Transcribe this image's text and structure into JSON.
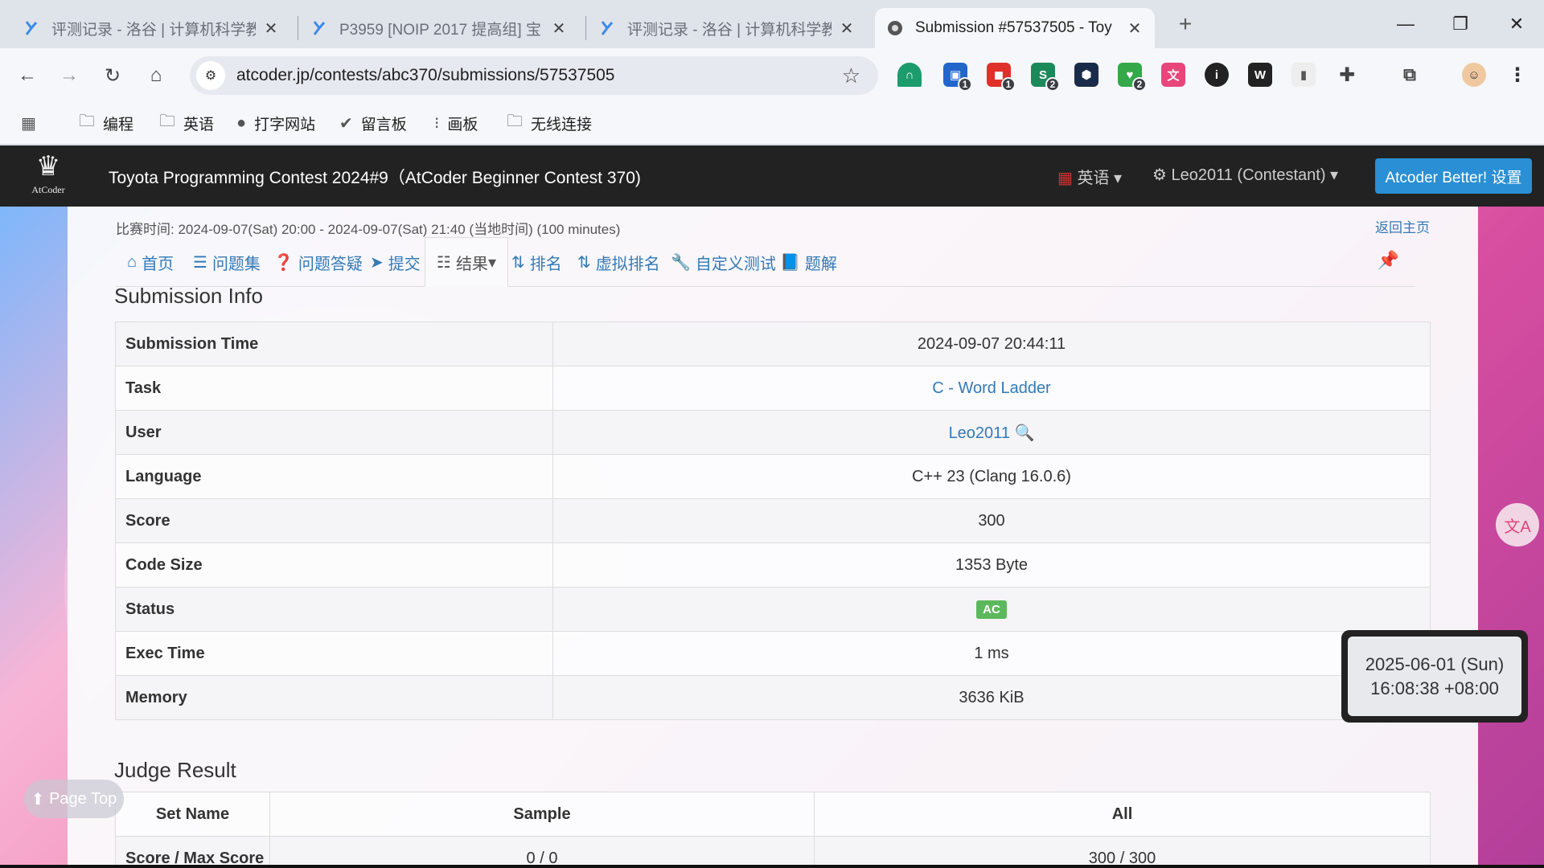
{
  "browser": {
    "tabs": [
      {
        "title": "评测记录 - 洛谷 | 计算机科学教",
        "icon": "luogu-icon"
      },
      {
        "title": "P3959 [NOIP 2017 提高组] 宝",
        "icon": "luogu-icon"
      },
      {
        "title": "评测记录 - 洛谷 | 计算机科学教",
        "icon": "luogu-icon"
      },
      {
        "title": "Submission #57537505 - Toy",
        "icon": "atcoder-icon",
        "active": true
      }
    ],
    "url": "atcoder.jp/contests/abc370/submissions/57537505",
    "extension_badges": {
      "ext2": "1",
      "ext3": "1",
      "ext4": "2",
      "ext6": "2"
    },
    "bookmarks": [
      {
        "label": "编程",
        "icon": "folder-icon"
      },
      {
        "label": "英语",
        "icon": "folder-icon"
      },
      {
        "label": "打字网站",
        "icon": "bookmark-site-icon"
      },
      {
        "label": "留言板",
        "icon": "bookmark-site-icon"
      },
      {
        "label": "画板",
        "icon": "bookmark-site-icon"
      },
      {
        "label": "无线连接",
        "icon": "folder-icon"
      }
    ]
  },
  "header": {
    "logo_text": "AtCoder",
    "contest_title": "Toyota Programming Contest 2024#9（AtCoder Beginner Contest 370)",
    "language": "英语",
    "user": "Leo2011 (Contestant)",
    "better_button": "Atcoder Better! 设置"
  },
  "contest": {
    "time": "比赛时间: 2024-09-07(Sat) 20:00 - 2024-09-07(Sat) 21:40 (当地时间) (100 minutes)",
    "back_home": "返回主页",
    "tabs": [
      {
        "label": "首页",
        "icon": "home-icon"
      },
      {
        "label": "问题集",
        "icon": "list-icon"
      },
      {
        "label": "问题答疑",
        "icon": "question-icon"
      },
      {
        "label": "提交",
        "icon": "send-icon"
      },
      {
        "label": "结果",
        "icon": "results-icon",
        "active": true
      },
      {
        "label": "排名",
        "icon": "sort-icon"
      },
      {
        "label": "虚拟排名",
        "icon": "sort-icon"
      },
      {
        "label": "自定义测试",
        "icon": "wrench-icon"
      },
      {
        "label": "题解",
        "icon": "book-icon"
      }
    ]
  },
  "submission_info": {
    "heading": "Submission Info",
    "rows": [
      {
        "key": "Submission Time",
        "value": "2024-09-07 20:44:11"
      },
      {
        "key": "Task",
        "value": "C - Word Ladder",
        "link": true
      },
      {
        "key": "User",
        "value": "Leo2011",
        "link": true,
        "search": true
      },
      {
        "key": "Language",
        "value": "C++ 23 (Clang 16.0.6)"
      },
      {
        "key": "Score",
        "value": "300"
      },
      {
        "key": "Code Size",
        "value": "1353 Byte"
      },
      {
        "key": "Status",
        "value": "AC",
        "badge": true
      },
      {
        "key": "Exec Time",
        "value": "1 ms"
      },
      {
        "key": "Memory",
        "value": "3636 KiB"
      }
    ]
  },
  "judge_result": {
    "heading": "Judge Result",
    "columns": [
      "Set Name",
      "Sample",
      "All"
    ],
    "rows": [
      {
        "key": "Score / Max Score",
        "sample": "0 / 0",
        "all": "300 / 300"
      }
    ]
  },
  "page_top": "Page Top",
  "clock": {
    "date": "2025-06-01 (Sun)",
    "time": "16:08:38 +08:00"
  },
  "colors": {
    "accent": "#337ab7",
    "ac_green": "#5cb85c",
    "header_bg": "#222222",
    "better_btn": "#2a8fd4"
  }
}
